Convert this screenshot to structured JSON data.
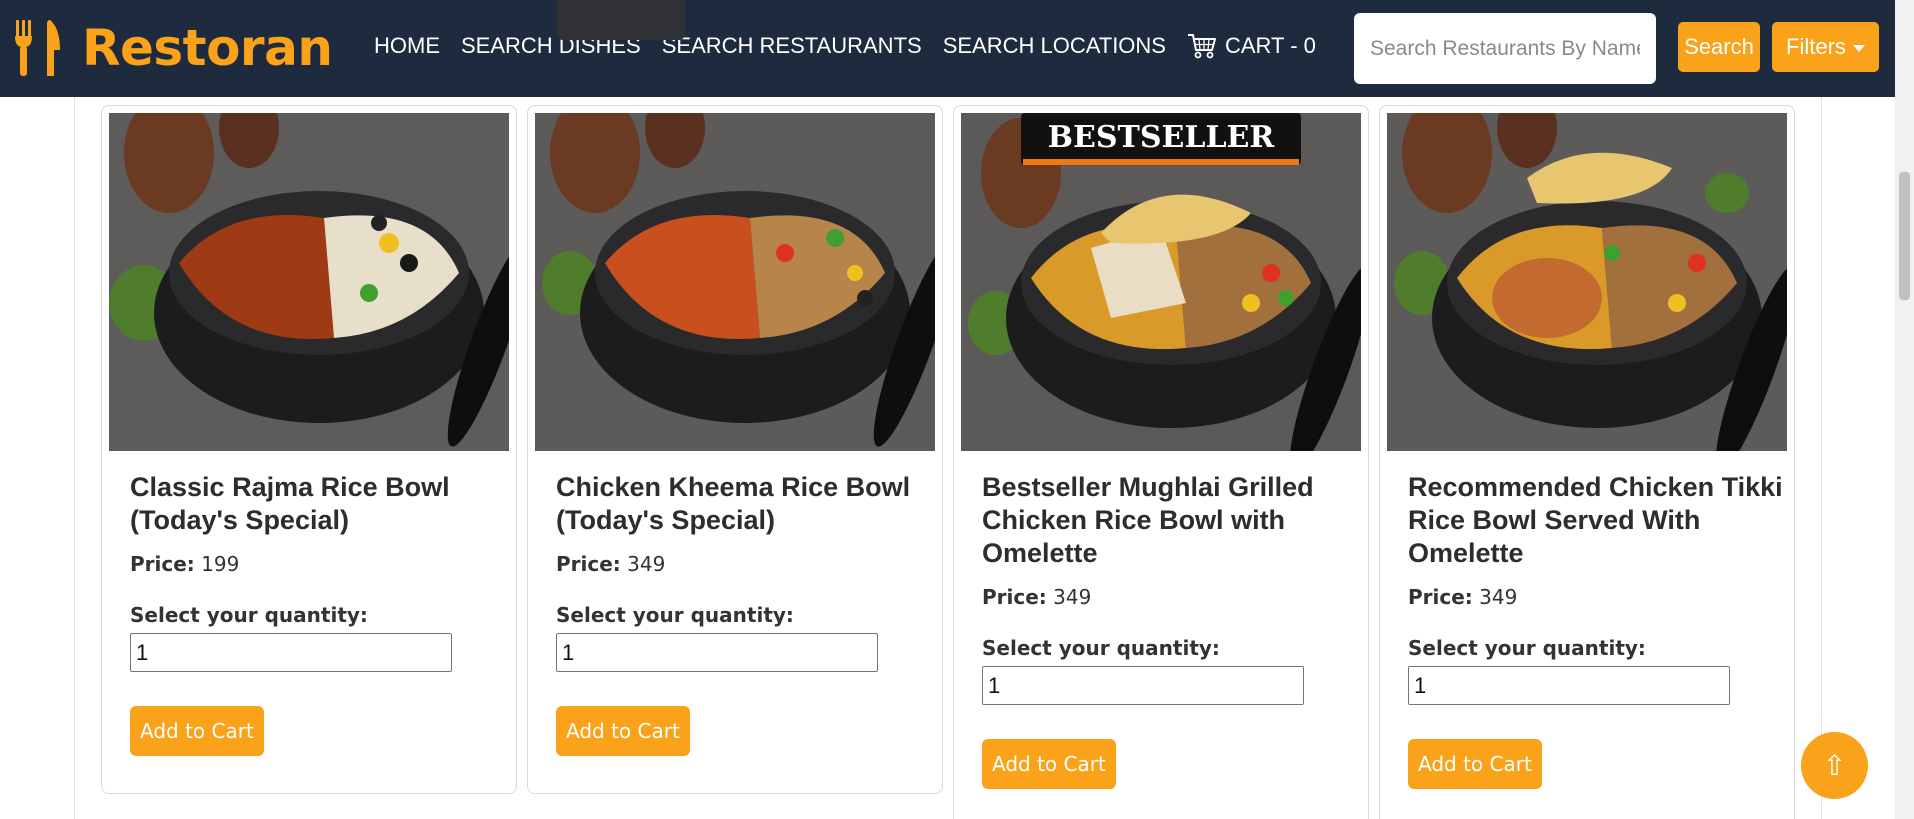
{
  "brand": {
    "name": "Restoran"
  },
  "nav": {
    "links": [
      "HOME",
      "SEARCH DISHES",
      "SEARCH RESTAURANTS",
      "SEARCH LOCATIONS"
    ],
    "cart_label": "CART - 0"
  },
  "search": {
    "placeholder": "Search Restaurants By Name",
    "button_label": "Search",
    "filters_label": "Filters"
  },
  "colors": {
    "accent": "#f9a21a",
    "navbar": "#1e2a3d"
  },
  "products": [
    {
      "title": "Classic Rajma Rice Bowl (Today's Special)",
      "price_label": "Price:",
      "price": "199",
      "qty_label": "Select your quantity:",
      "qty": "1",
      "button": "Add to Cart",
      "image": "rajma-rice-bowl"
    },
    {
      "title": "Chicken Kheema Rice Bowl (Today's Special)",
      "price_label": "Price:",
      "price": "349",
      "qty_label": "Select your quantity:",
      "qty": "1",
      "button": "Add to Cart",
      "image": "kheema-rice-bowl"
    },
    {
      "title": "Bestseller Mughlai Grilled Chicken Rice Bowl with Omelette",
      "price_label": "Price:",
      "price": "349",
      "qty_label": "Select your quantity:",
      "qty": "1",
      "button": "Add to Cart",
      "image": "mughlai-chicken-bowl",
      "badge": "BESTSELLER"
    },
    {
      "title": "Recommended Chicken Tikki Rice Bowl Served With Omelette",
      "price_label": "Price:",
      "price": "349",
      "qty_label": "Select your quantity:",
      "qty": "1",
      "button": "Add to Cart",
      "image": "chicken-tikki-bowl"
    }
  ],
  "scroll_top_icon": "up-arrow-icon"
}
